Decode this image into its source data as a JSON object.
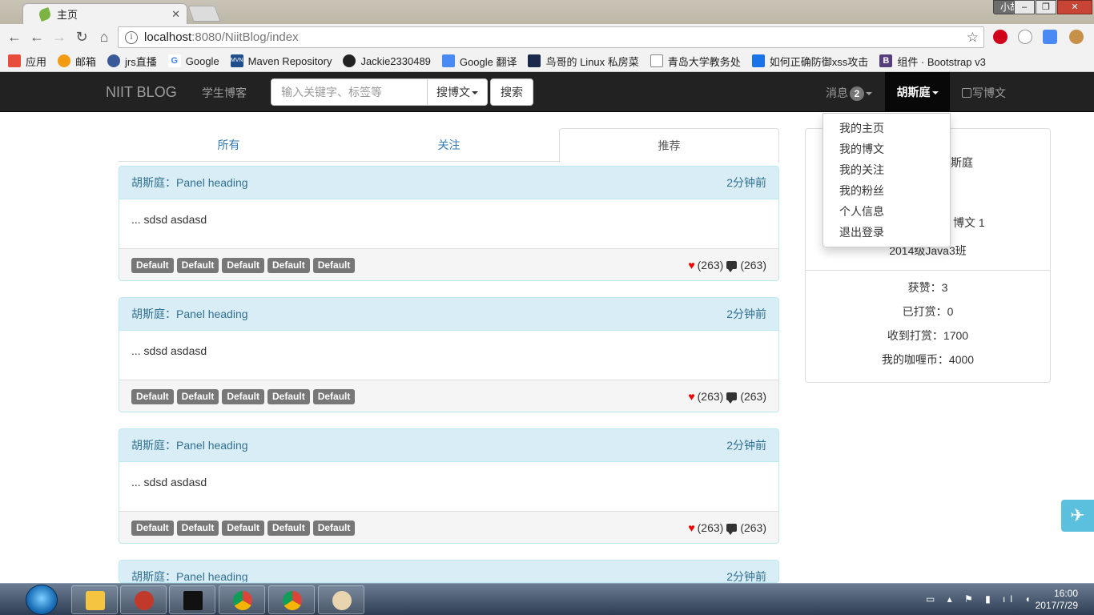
{
  "browser": {
    "tab_title": "主页",
    "tab_close": "✕",
    "user_badge": "小胡",
    "window_buttons": [
      "‒",
      "❐",
      "✕"
    ],
    "url_host": "localhost",
    "url_rest": ":8080/NiitBlog/index"
  },
  "bookmarks": [
    {
      "label": "应用",
      "color": "#e74c3c"
    },
    {
      "label": "邮箱",
      "color": "#f39c12"
    },
    {
      "label": "jrs直播",
      "color": "#3b5998"
    },
    {
      "label": "Google",
      "color": "#4285f4"
    },
    {
      "label": "Maven Repository",
      "color": "#1f4e8c"
    },
    {
      "label": "Jackie2330489",
      "color": "#222222"
    },
    {
      "label": "Google 翻译",
      "color": "#4a8af4"
    },
    {
      "label": "鸟哥的 Linux 私房菜",
      "color": "#1b2a4a"
    },
    {
      "label": "青岛大学教务处",
      "color": "#888888"
    },
    {
      "label": "如何正确防御xss攻击",
      "color": "#1a73e8"
    },
    {
      "label": "组件 · Bootstrap v3",
      "color": "#563d7c"
    }
  ],
  "nav": {
    "brand": "NIIT BLOG",
    "link": "学生博客",
    "search_placeholder": "输入关键字、标签等",
    "search_type": "搜博文",
    "search_button": "搜索",
    "messages_label": "消息",
    "messages_count": "2",
    "user_name": "胡斯庭",
    "write_label": "写博文"
  },
  "user_menu": [
    "我的主页",
    "我的博文",
    "我的关注",
    "我的粉丝",
    "个人信息",
    "退出登录"
  ],
  "tabs": [
    {
      "label": "所有",
      "active": false
    },
    {
      "label": "关注",
      "active": false
    },
    {
      "label": "推荐",
      "active": true
    }
  ],
  "posts": [
    {
      "heading": "胡斯庭：Panel heading",
      "time": "2分钟前",
      "body": "... sdsd asdasd",
      "tags": [
        "Default",
        "Default",
        "Default",
        "Default",
        "Default"
      ],
      "likes": "(263)",
      "comments": "(263)"
    },
    {
      "heading": "胡斯庭：Panel heading",
      "time": "2分钟前",
      "body": "... sdsd asdasd",
      "tags": [
        "Default",
        "Default",
        "Default",
        "Default",
        "Default"
      ],
      "likes": "(263)",
      "comments": "(263)"
    },
    {
      "heading": "胡斯庭：Panel heading",
      "time": "2分钟前",
      "body": "... sdsd asdasd",
      "tags": [
        "Default",
        "Default",
        "Default",
        "Default",
        "Default"
      ],
      "likes": "(263)",
      "comments": "(263)"
    },
    {
      "heading": "胡斯庭：Panel heading",
      "time": "2分钟前"
    }
  ],
  "profile": {
    "name_partial": "斯庭",
    "line2_partial": "!",
    "posts_partial": "博文 1",
    "class": "2014级Java3班",
    "likes": "获赞：3",
    "tipped": "已打赏：0",
    "received": "收到打赏：1700",
    "coins": "我的咖喱币：4000"
  },
  "taskbar": {
    "time": "16:00",
    "date": "2017/7/29"
  }
}
